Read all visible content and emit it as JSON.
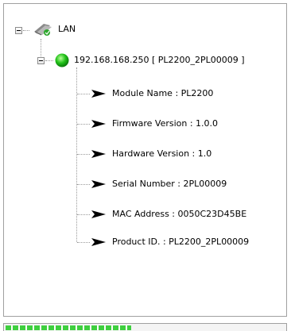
{
  "tree": {
    "root": {
      "label": "LAN",
      "icon": "network-cable-icon"
    },
    "device": {
      "label": "192.168.168.250 [ PL2200_2PL00009 ]",
      "icon": "green-status-icon",
      "status_color": "#22c21a"
    },
    "properties": [
      {
        "label": "Module Name : PL2200"
      },
      {
        "label": "Firmware Version : 1.0.0"
      },
      {
        "label": "Hardware Version : 1.0"
      },
      {
        "label": "Serial Number : 2PL00009"
      },
      {
        "label": "MAC Address : 0050C23D45BE"
      },
      {
        "label": "Product ID. : PL2200_2PL00009"
      }
    ]
  },
  "status_bar": {
    "progress_fraction": 0.45,
    "progress_color": "#3fcf3f"
  }
}
